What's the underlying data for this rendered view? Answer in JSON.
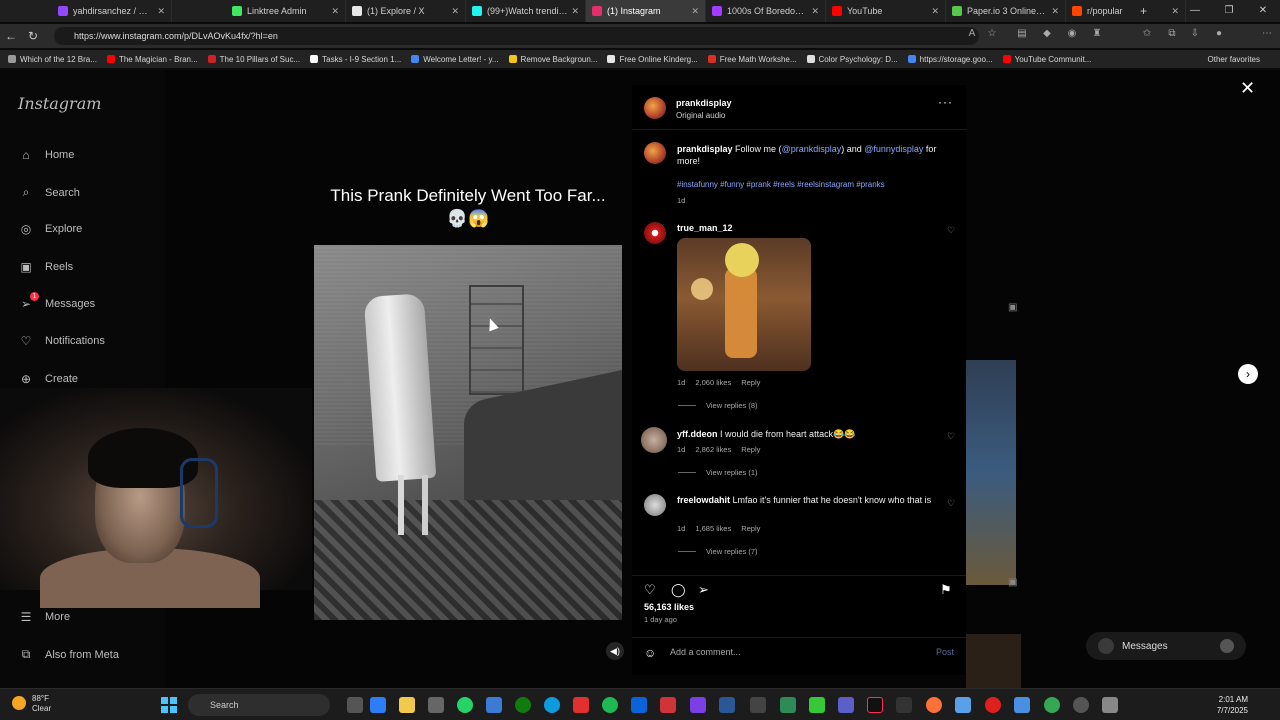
{
  "browser": {
    "tabs": [
      {
        "label": "yahdirsanchez / Strea",
        "color": "#9146ff"
      },
      {
        "label": "Linktree Admin",
        "color": "#43e660"
      },
      {
        "label": "(1) Explore / X",
        "color": "#e7e7e7"
      },
      {
        "label": "(99+)Watch trending",
        "color": "#25f4ee"
      },
      {
        "label": "(1) Instagram",
        "color": "#e1306c"
      },
      {
        "label": "1000s Of Boredom W",
        "color": "#a13bff"
      },
      {
        "label": "YouTube",
        "color": "#ff0000"
      },
      {
        "label": "Paper.io 3 Online Offi",
        "color": "#57c84d"
      },
      {
        "label": "r/popular",
        "color": "#ff4500"
      }
    ],
    "url": "https://www.instagram.com/p/DLvAOvKu4fx/?hl=en",
    "bookmarks": [
      {
        "label": "Which of the 12 Bra...",
        "color": "#9a9a9a"
      },
      {
        "label": "The Magician - Bran...",
        "color": "#ff0000"
      },
      {
        "label": "The 10 Pillars of Suc...",
        "color": "#cc2222"
      },
      {
        "label": "Tasks - I-9 Section 1...",
        "color": "#ffffff"
      },
      {
        "label": "Welcome Letter! - y...",
        "color": "#4285f4"
      },
      {
        "label": "Remove Backgroun...",
        "color": "#f5c518"
      },
      {
        "label": "Free Online Kinderg...",
        "color": "#e6e6e6"
      },
      {
        "label": "Free Math Workshe...",
        "color": "#d93025"
      },
      {
        "label": "Color Psychology: D...",
        "color": "#dddddd"
      },
      {
        "label": "https://storage.goo...",
        "color": "#4285f4"
      },
      {
        "label": "YouTube Communit...",
        "color": "#ff0000"
      }
    ],
    "other_favorites": "Other favorites"
  },
  "sidebar": {
    "logo": "Instagram",
    "items": [
      {
        "label": "Home",
        "icon": "⌂"
      },
      {
        "label": "Search",
        "icon": "⌕"
      },
      {
        "label": "Explore",
        "icon": "◎"
      },
      {
        "label": "Reels",
        "icon": "▣"
      },
      {
        "label": "Messages",
        "icon": "➢"
      },
      {
        "label": "Notifications",
        "icon": "♡"
      },
      {
        "label": "Create",
        "icon": "⊕"
      }
    ],
    "messages_badge": "1",
    "more": "More",
    "also_from_meta": "Also from Meta"
  },
  "video": {
    "title": "This Prank Definitely Went Too Far... 💀😱"
  },
  "post": {
    "author": "prankdisplay",
    "audio": "Original audio",
    "caption_author": "prankdisplay",
    "caption_text_1": "Follow me (",
    "caption_link_1": "@prankdisplay",
    "caption_text_2": ") and ",
    "caption_link_2": "@funnydisplay",
    "caption_text_3": " for more!",
    "hashtags": "#instafunny #funny #prank #reels #reelsinstagram #pranks",
    "caption_age": "1d",
    "comments": [
      {
        "user": "true_man_12",
        "text": "",
        "age": "1d",
        "likes": "2,060 likes",
        "reply": "Reply",
        "view_replies": "View replies (8)"
      },
      {
        "user": "yff.ddeon",
        "text": "I would die from heart attack😂😂",
        "age": "1d",
        "likes": "2,862 likes",
        "reply": "Reply",
        "view_replies": "View replies (1)"
      },
      {
        "user": "freelowdahit",
        "text": "Lmfao it's funnier that he doesn't know who that is",
        "age": "1d",
        "likes": "1,685 likes",
        "reply": "Reply",
        "view_replies": "View replies (7)"
      }
    ],
    "likes_total": "56,163 likes",
    "posted_ago": "1 day ago",
    "add_comment_placeholder": "Add a comment...",
    "post_button": "Post"
  },
  "floating": {
    "messages": "Messages"
  },
  "taskbar": {
    "temperature": "88°F",
    "condition": "Clear",
    "search": "Search",
    "time": "2:01 AM",
    "date": "7/7/2025"
  }
}
